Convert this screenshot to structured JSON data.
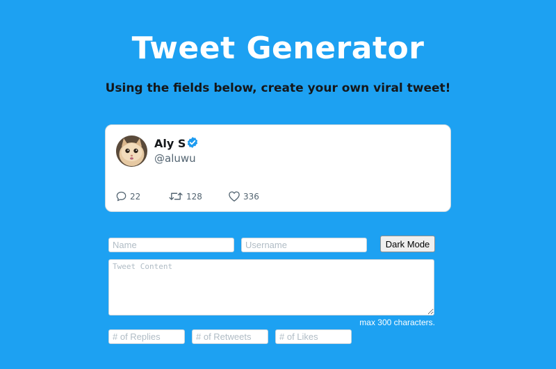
{
  "header": {
    "title": "Tweet Generator",
    "subtitle": "Using the fields below, create your own viral tweet!"
  },
  "tweet": {
    "name": "Aly S",
    "handle": "@aluwu",
    "content": "",
    "replies": "22",
    "retweets": "128",
    "likes": "336"
  },
  "form": {
    "name_placeholder": "Name",
    "username_placeholder": "Username",
    "content_placeholder": "Tweet Content",
    "dark_mode_label": "Dark Mode",
    "max_chars_note": "max 300 characters.",
    "replies_placeholder": "# of Replies",
    "retweets_placeholder": "# of Retweets",
    "likes_placeholder": "# of Likes"
  },
  "colors": {
    "background": "#1da1f2",
    "verified": "#1d9bf0",
    "card": "#ffffff"
  },
  "icons": {
    "verified": "verified-badge-icon",
    "reply": "speech-bubble-icon",
    "retweet": "retweet-arrows-icon",
    "like": "heart-icon"
  }
}
